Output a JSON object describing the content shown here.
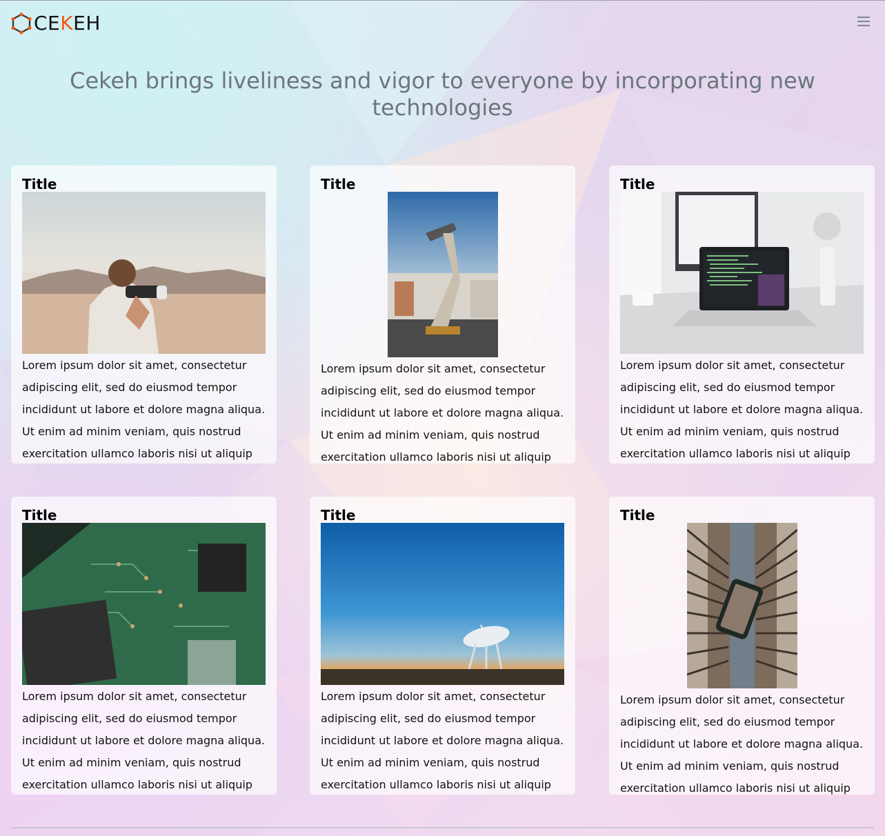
{
  "brand": {
    "name_pre": "CE",
    "name_accent": "K",
    "name_post": "EH",
    "accent_color": "#f05a13"
  },
  "hero": {
    "text": "Cekeh brings liveliness and vigor to everyone by incorporating new technologies"
  },
  "cards": [
    {
      "title": "Title",
      "image": "photographer-in-desert",
      "text": "Lorem ipsum dolor sit amet, consectetur adipiscing elit, sed do eiusmod tempor incididunt ut labore et dolore magna aliqua. Ut enim ad minim veniam, quis nostrud exercitation ullamco laboris nisi ut aliquip"
    },
    {
      "title": "Title",
      "image": "telescope-sculpture",
      "text": "Lorem ipsum dolor sit amet, consectetur adipiscing elit, sed do eiusmod tempor incididunt ut labore et dolore magna aliqua. Ut enim ad minim veniam, quis nostrud exercitation ullamco laboris nisi ut aliquip"
    },
    {
      "title": "Title",
      "image": "laptop-on-desk",
      "text": "Lorem ipsum dolor sit amet, consectetur adipiscing elit, sed do eiusmod tempor incididunt ut labore et dolore magna aliqua. Ut enim ad minim veniam, quis nostrud exercitation ullamco laboris nisi ut aliquip"
    },
    {
      "title": "Title",
      "image": "circuit-board",
      "text": "Lorem ipsum dolor sit amet, consectetur adipiscing elit, sed do eiusmod tempor incididunt ut labore et dolore magna aliqua. Ut enim ad minim veniam, quis nostrud exercitation ullamco laboris nisi ut aliquip"
    },
    {
      "title": "Title",
      "image": "radio-telescope-sunset",
      "text": "Lorem ipsum dolor sit amet, consectetur adipiscing elit, sed do eiusmod tempor incididunt ut labore et dolore magna aliqua. Ut enim ad minim veniam, quis nostrud exercitation ullamco laboris nisi ut aliquip"
    },
    {
      "title": "Title",
      "image": "phone-in-building",
      "text": "Lorem ipsum dolor sit amet, consectetur adipiscing elit, sed do eiusmod tempor incididunt ut labore et dolore magna aliqua. Ut enim ad minim veniam, quis nostrud exercitation ullamco laboris nisi ut aliquip"
    }
  ],
  "icons": {
    "logo": "hexagon-logo-icon",
    "menu": "hamburger-menu-icon"
  }
}
